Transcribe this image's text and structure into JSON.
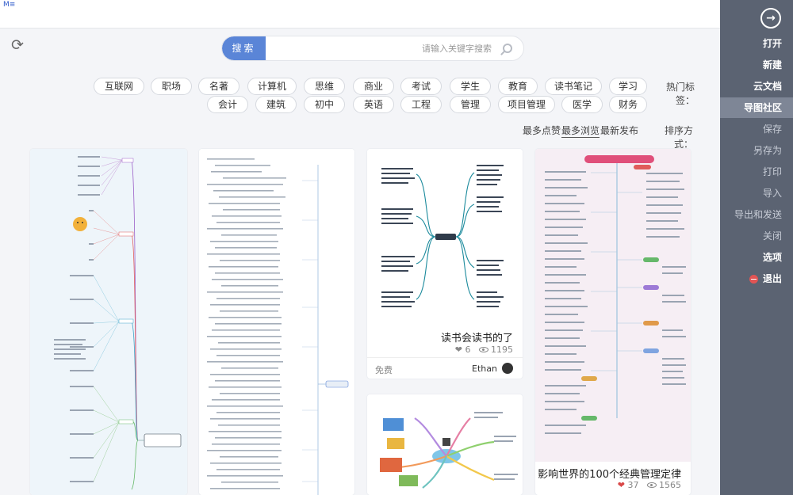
{
  "corner_mark": "M≡",
  "sidebar": {
    "back_glyph": "→",
    "items": [
      {
        "label": "打开",
        "dim": false
      },
      {
        "label": "新建",
        "dim": false
      },
      {
        "label": "云文档",
        "dim": false
      },
      {
        "label": "导图社区",
        "dim": false
      },
      {
        "label": "保存",
        "dim": true
      },
      {
        "label": "另存为",
        "dim": true
      },
      {
        "label": "打印",
        "dim": true
      },
      {
        "label": "导入",
        "dim": true
      },
      {
        "label": "导出和发送",
        "dim": true
      },
      {
        "label": "关闭",
        "dim": true
      },
      {
        "label": "选项",
        "dim": false
      },
      {
        "label": "退出",
        "dim": false
      }
    ],
    "active_index": 3
  },
  "refresh_glyph": "⟳",
  "search": {
    "button_label": "搜索",
    "placeholder": "请输入关键字搜索"
  },
  "tags": {
    "label": "热门标签：",
    "row1": [
      "学习",
      "读书笔记",
      "教育",
      "学生",
      "考试",
      "商业",
      "思维",
      "计算机",
      "名著",
      "职场",
      "互联网"
    ],
    "row2": [
      "财务",
      "医学",
      "项目管理",
      "管理",
      "工程",
      "英语",
      "初中",
      "建筑",
      "会计"
    ]
  },
  "sort": {
    "label": "排序方式：",
    "options": [
      "最新发布",
      "最多浏览",
      "最多点赞"
    ],
    "active_index": 1
  },
  "cards": {
    "c1": {
      "title": "影响世界的100个经典管理定律",
      "views": "1565",
      "likes": "37"
    },
    "c2": {
      "title": "读书会读书的了",
      "views": "1195",
      "likes": "6",
      "author": "Ethan",
      "price": "免费"
    }
  },
  "colors": {
    "sidebar_bg": "#5b6372",
    "sidebar_active": "#7e8696",
    "accent": "#5a85d7",
    "heart": "#d94848"
  }
}
